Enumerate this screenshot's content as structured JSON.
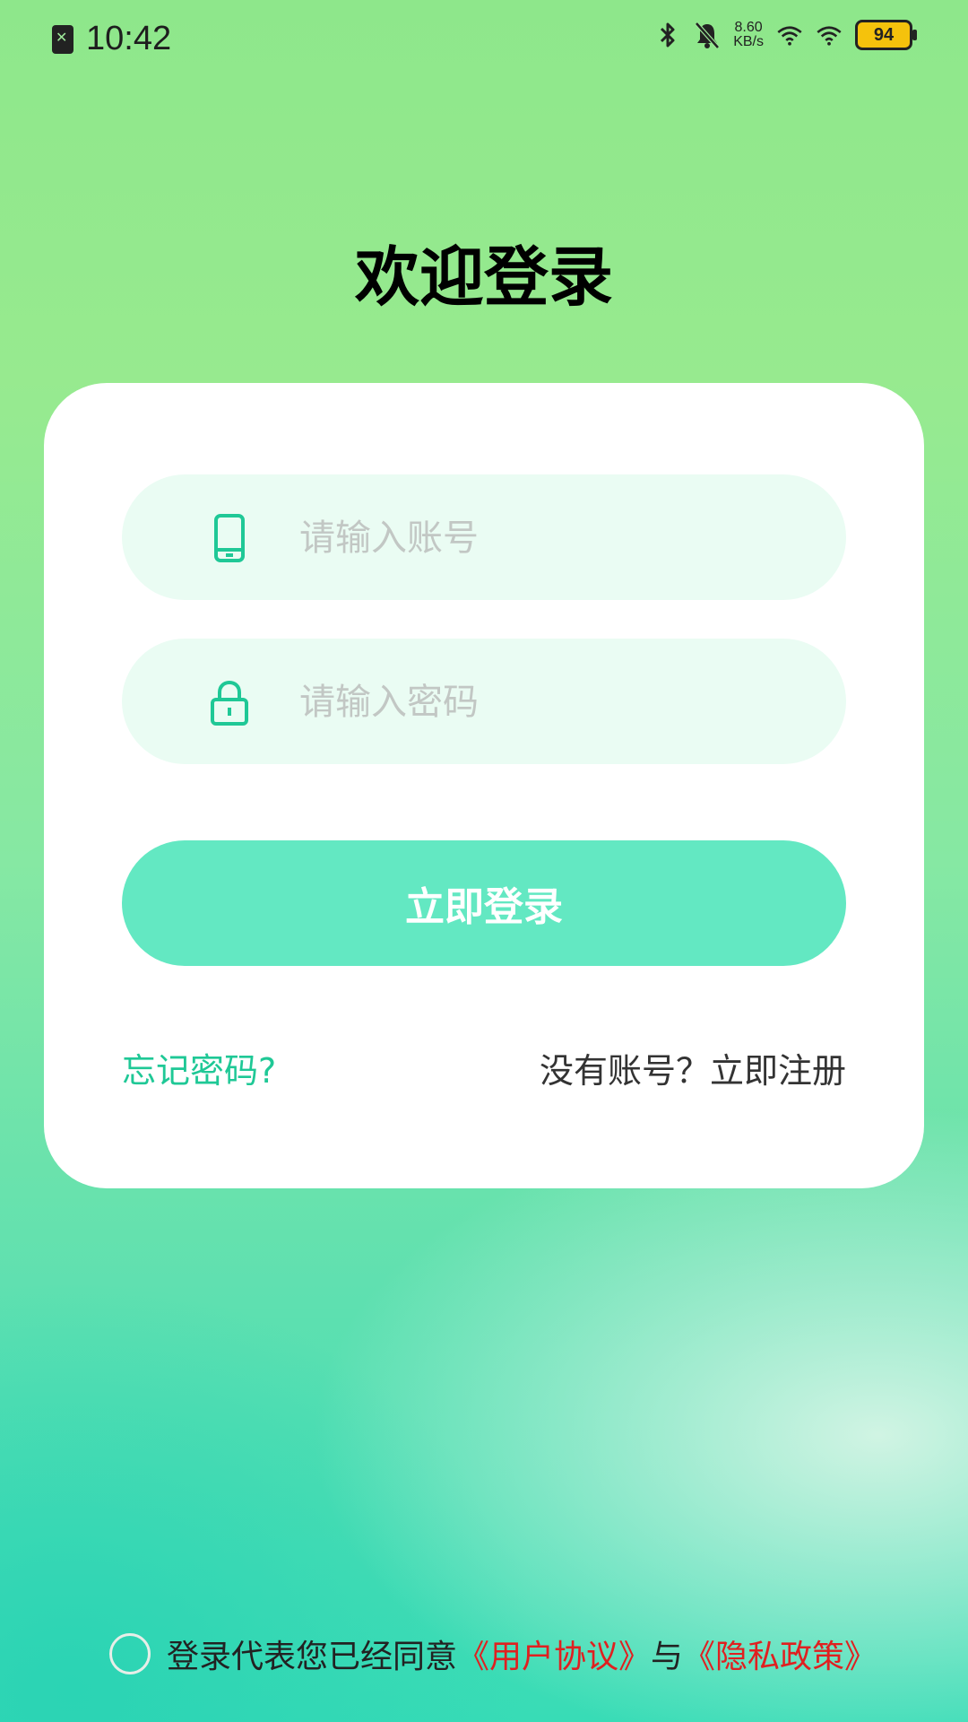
{
  "status_bar": {
    "time": "10:42",
    "net_speed_value": "8.60",
    "net_speed_unit": "KB/s",
    "battery": "94",
    "icons": [
      "sim-error-icon",
      "bluetooth-icon",
      "mute-bell-icon",
      "wifi-icon",
      "wifi-icon",
      "battery-icon"
    ],
    "battery_color": "#f5c20c"
  },
  "title": "欢迎登录",
  "form": {
    "account_placeholder": "请输入账号",
    "account_icon": "phone-icon",
    "password_placeholder": "请输入密码",
    "password_icon": "lock-icon",
    "submit_label": "立即登录",
    "forgot_label": "忘记密码?",
    "register_label": "没有账号？立即注册"
  },
  "agreement": {
    "prefix": "登录代表您已经同意",
    "user_agreement": "《用户协议》",
    "conjunction": "与",
    "privacy_policy": "《隐私政策》",
    "checked": false
  },
  "colors": {
    "accent_green": "#1fc896",
    "button_green": "#63e8c2",
    "link_red": "#e02020",
    "field_bg": "#eafcf3"
  }
}
